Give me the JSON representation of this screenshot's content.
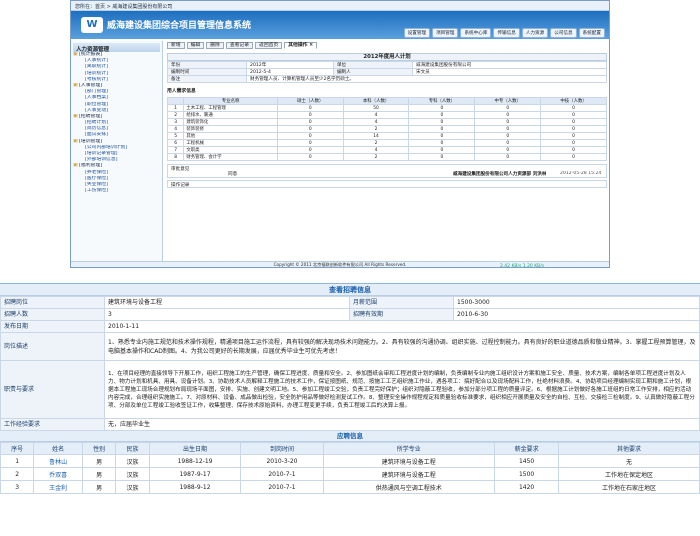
{
  "app": {
    "breadcrumb": "您所在：首页 > 威海建设集团股份有限公司",
    "logo_text": "W",
    "title": "威海建设集团综合项目管理信息系统",
    "top_nav": [
      "设置管理",
      "项目管理",
      "系统中心库",
      "传输信息",
      "人力资源",
      "公司信息",
      "系统配置"
    ],
    "sidebar": {
      "heading": "人力资源管理",
      "items": [
        {
          "label": "[统计报表]",
          "level": 1
        },
        {
          "label": "[人事统计]",
          "level": 2
        },
        {
          "label": "[离职统计]",
          "level": 2
        },
        {
          "label": "[培训统计]",
          "level": 2
        },
        {
          "label": "[考核统计]",
          "level": 2
        },
        {
          "label": "[人事管理]",
          "level": 1
        },
        {
          "label": "[部门管理]",
          "level": 2
        },
        {
          "label": "[人事档案]",
          "level": 2
        },
        {
          "label": "[职位管理]",
          "level": 2
        },
        {
          "label": "[人事变动]",
          "level": 2
        },
        {
          "label": "[招聘管理]",
          "level": 1
        },
        {
          "label": "[招聘计划]",
          "level": 2
        },
        {
          "label": "[简历信息]",
          "level": 2
        },
        {
          "label": "[面试安排]",
          "level": 2
        },
        {
          "label": "[培训管理]",
          "level": 1
        },
        {
          "label": "[公司内部培训计划]",
          "level": 2
        },
        {
          "label": "[培训记录管理]",
          "level": 2
        },
        {
          "label": "[外部培训信息]",
          "level": 2
        },
        {
          "label": "[福利管理]",
          "level": 1
        },
        {
          "label": "[养老保险]",
          "level": 2
        },
        {
          "label": "[医疗保险]",
          "level": 2
        },
        {
          "label": "[失业保险]",
          "level": 2
        },
        {
          "label": "[工伤保险]",
          "level": 2
        }
      ]
    },
    "tabs": [
      "新增",
      "编辑",
      "删除",
      "查看记录",
      "返回首页",
      "其他操作 ×"
    ],
    "plan": {
      "title": "2012年度用人计划",
      "fields": [
        [
          "年份",
          "2012年",
          "单位",
          "威海建设集团股份有限公司"
        ],
        [
          "编制时间",
          "2012-5-4",
          "编制人",
          "宋文员"
        ],
        [
          "备注",
          "财务管理人员、计算机管理人员至少2名学历硕士。",
          "",
          ""
        ]
      ],
      "stat_caption": "用人需求信息",
      "stat_headers": [
        "",
        "专业名称",
        "硕士（人数）",
        "本科（人数）",
        "专科（人数）",
        "中专（人数）",
        "中技（人数）"
      ],
      "stat_rows": [
        [
          "1",
          "土木工程、工程管理",
          "0",
          "50",
          "0",
          "0",
          "0"
        ],
        [
          "2",
          "给排水、暖通",
          "0",
          "4",
          "0",
          "0",
          "0"
        ],
        [
          "3",
          "建筑装饰化",
          "0",
          "4",
          "0",
          "0",
          "0"
        ],
        [
          "4",
          "装饰装修",
          "0",
          "2",
          "0",
          "0",
          "0"
        ],
        [
          "5",
          "其他",
          "0",
          "14",
          "0",
          "0",
          "0"
        ],
        [
          "6",
          "工程机械",
          "0",
          "2",
          "0",
          "0",
          "0"
        ],
        [
          "7",
          "文职类",
          "0",
          "4",
          "0",
          "0",
          "0"
        ],
        [
          "8",
          "财务管理、会计学",
          "0",
          "2",
          "0",
          "0",
          "0"
        ]
      ],
      "approval_label": "审批意见",
      "approval_value": "同意",
      "signer": "威海建设集团股份有限公司人力资源部 刘洪林",
      "sign_time": "2012-05-28 15:24",
      "flow_label": "操作记录"
    },
    "statusbar": "Copyright © 2011 北京福联创新软件有限公司 All Rights Reserved.",
    "speed": "2.42 KB/s    1.20 KB/s"
  },
  "recruit": {
    "title": "查看招聘信息",
    "rows": [
      {
        "k1": "招聘岗位",
        "v1": "建筑环境与设备工程",
        "k2": "月薪范围",
        "v2": "1500-3000"
      },
      {
        "k1": "招聘人数",
        "v1": "3",
        "k2": "招聘有效期",
        "v2": "2010-6-30"
      }
    ],
    "publish_label": "发布日期",
    "publish_value": "2010-1-11",
    "desc_label": "岗位描述",
    "desc_value": "1、熟悉专业内施工规范和技术操作规程，精通项目施工运作流程，具有较强的解决现场技术问题能力。2、具有较强的沟通协调、组织实施、过程控制能力。具有良好的职业道德品质和敬业精神。3、掌握工程预算管理，及电脑基本操作和CAD制图。4、为我公司更好的长期发展，应届优秀毕业生可优先考虑！",
    "duty_label": "职责与要求",
    "duty_value": "1、在项目经理的直接领导下开展工作，组织工程施工的生产管理，确保工程进度、质量和安全。2、参加图纸会审和工程进度计划的编制，负责编制专业内施工组织设计方案和施工安全、质量、技术方案，编制各单项工程进度计划及人力、物力计划和机具、用具、设备计划。3、协助技术人员解释工程施工的技术工作，保证按图纸、规范、按施工工艺组织施工作业，遇各项工：搞好配合以及现场配料工作，杜绝材料浪费。4、协助项目经理编制实现工期和施工计划，根据本工程施工现场合理规划布局现场平面图，安排、实施、创建文明工地。5、参加工程竣工交验，负责工程完好保护；组织对隐蔽工程验收，参加分部分项工程的质量评定。6、根据施工计划做好各施工班组的日常工作安排，相应的活动内容完成，合理组织实施施工。7、对原材料、设备、成品做出检验，安全防护用品等做好检测复试工作。8、整理安全操作规程规定和质量验收标准要求，组织相应开展质量及安全的自检、互检、交接检三检制度。9、认真做好隐蔽工程分项、分部及单位工程竣工验收签证工作，收集整理、保存技术原始资料，办理工程变更手续，负责工程竣工后的决算上报。",
    "exp_label": "工作经验要求",
    "exp_value": "无，应届毕业生",
    "applicants_title": "应聘信息",
    "applicant_headers": [
      "序号",
      "姓名",
      "性别",
      "民族",
      "出生日期",
      "到岗时间",
      "所学专业",
      "薪金要求",
      "其他要求"
    ],
    "applicants": [
      [
        "1",
        "鲁林山",
        "男",
        "汉族",
        "1988-12-19",
        "2010-3-20",
        "建筑环境与设备工程",
        "1450",
        "无"
      ],
      [
        "2",
        "乔双喜",
        "男",
        "汉族",
        "1987-9-17",
        "2010-7-1",
        "建筑环境与设备工程",
        "1500",
        "工作地在保定地区"
      ],
      [
        "3",
        "王金利",
        "男",
        "汉族",
        "1988-9-12",
        "2010-7-1",
        "供热通风与空调工程技术",
        "1420",
        "工作地在石家庄地区"
      ]
    ]
  }
}
